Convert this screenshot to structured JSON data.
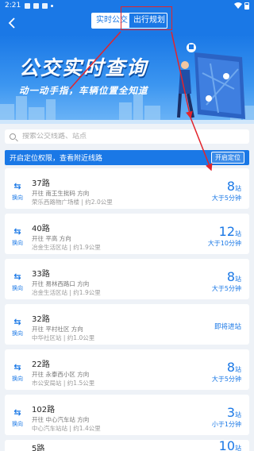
{
  "status": {
    "time": "2:21"
  },
  "header": {
    "tabs": [
      {
        "label": "实时公交",
        "active": true
      },
      {
        "label": "出行规划",
        "active": false
      }
    ]
  },
  "banner": {
    "title": "公交实时查询",
    "subtitle": "动一动手指，车辆位置全知道"
  },
  "search": {
    "placeholder": "搜索公交线路、站点"
  },
  "location_bar": {
    "text": "开启定位权限，查看附近线路",
    "button": "开启定位"
  },
  "routes": [
    {
      "swap_label": "换向",
      "name": "37路",
      "direction": "开往 南王生批码 方向",
      "location": "荣乐西路物广场楼 | 约2.0公里",
      "stops": "8",
      "unit": "站",
      "eta": "大于5分钟",
      "arriving": ""
    },
    {
      "swap_label": "换向",
      "name": "40路",
      "direction": "开往 平高 方向",
      "location": "冶金生活区站 | 约1.9公里",
      "stops": "12",
      "unit": "站",
      "eta": "大于10分钟",
      "arriving": ""
    },
    {
      "swap_label": "换向",
      "name": "33路",
      "direction": "开往 易林西路口 方向",
      "location": "冶金生活区站 | 约1.9公里",
      "stops": "8",
      "unit": "站",
      "eta": "大于5分钟",
      "arriving": ""
    },
    {
      "swap_label": "换向",
      "name": "32路",
      "direction": "开往 平村社区 方向",
      "location": "中华社区站 | 约1.0公里",
      "stops": "",
      "unit": "",
      "eta": "",
      "arriving": "即将进站"
    },
    {
      "swap_label": "换向",
      "name": "22路",
      "direction": "开往 永泰西小区 方向",
      "location": "市公安局站 | 约1.5公里",
      "stops": "8",
      "unit": "站",
      "eta": "大于5分钟",
      "arriving": ""
    },
    {
      "swap_label": "换向",
      "name": "102路",
      "direction": "开往 中心汽车站 方向",
      "location": "中心汽车站站 | 约1.4公里",
      "stops": "3",
      "unit": "站",
      "eta": "小于1分钟",
      "arriving": ""
    },
    {
      "swap_label": "换向",
      "name": "5路",
      "direction": "",
      "location": "",
      "stops": "10",
      "unit": "站",
      "eta": "",
      "arriving": ""
    }
  ],
  "colors": {
    "brand": "#1a78e6",
    "annotation": "#e3242b"
  }
}
